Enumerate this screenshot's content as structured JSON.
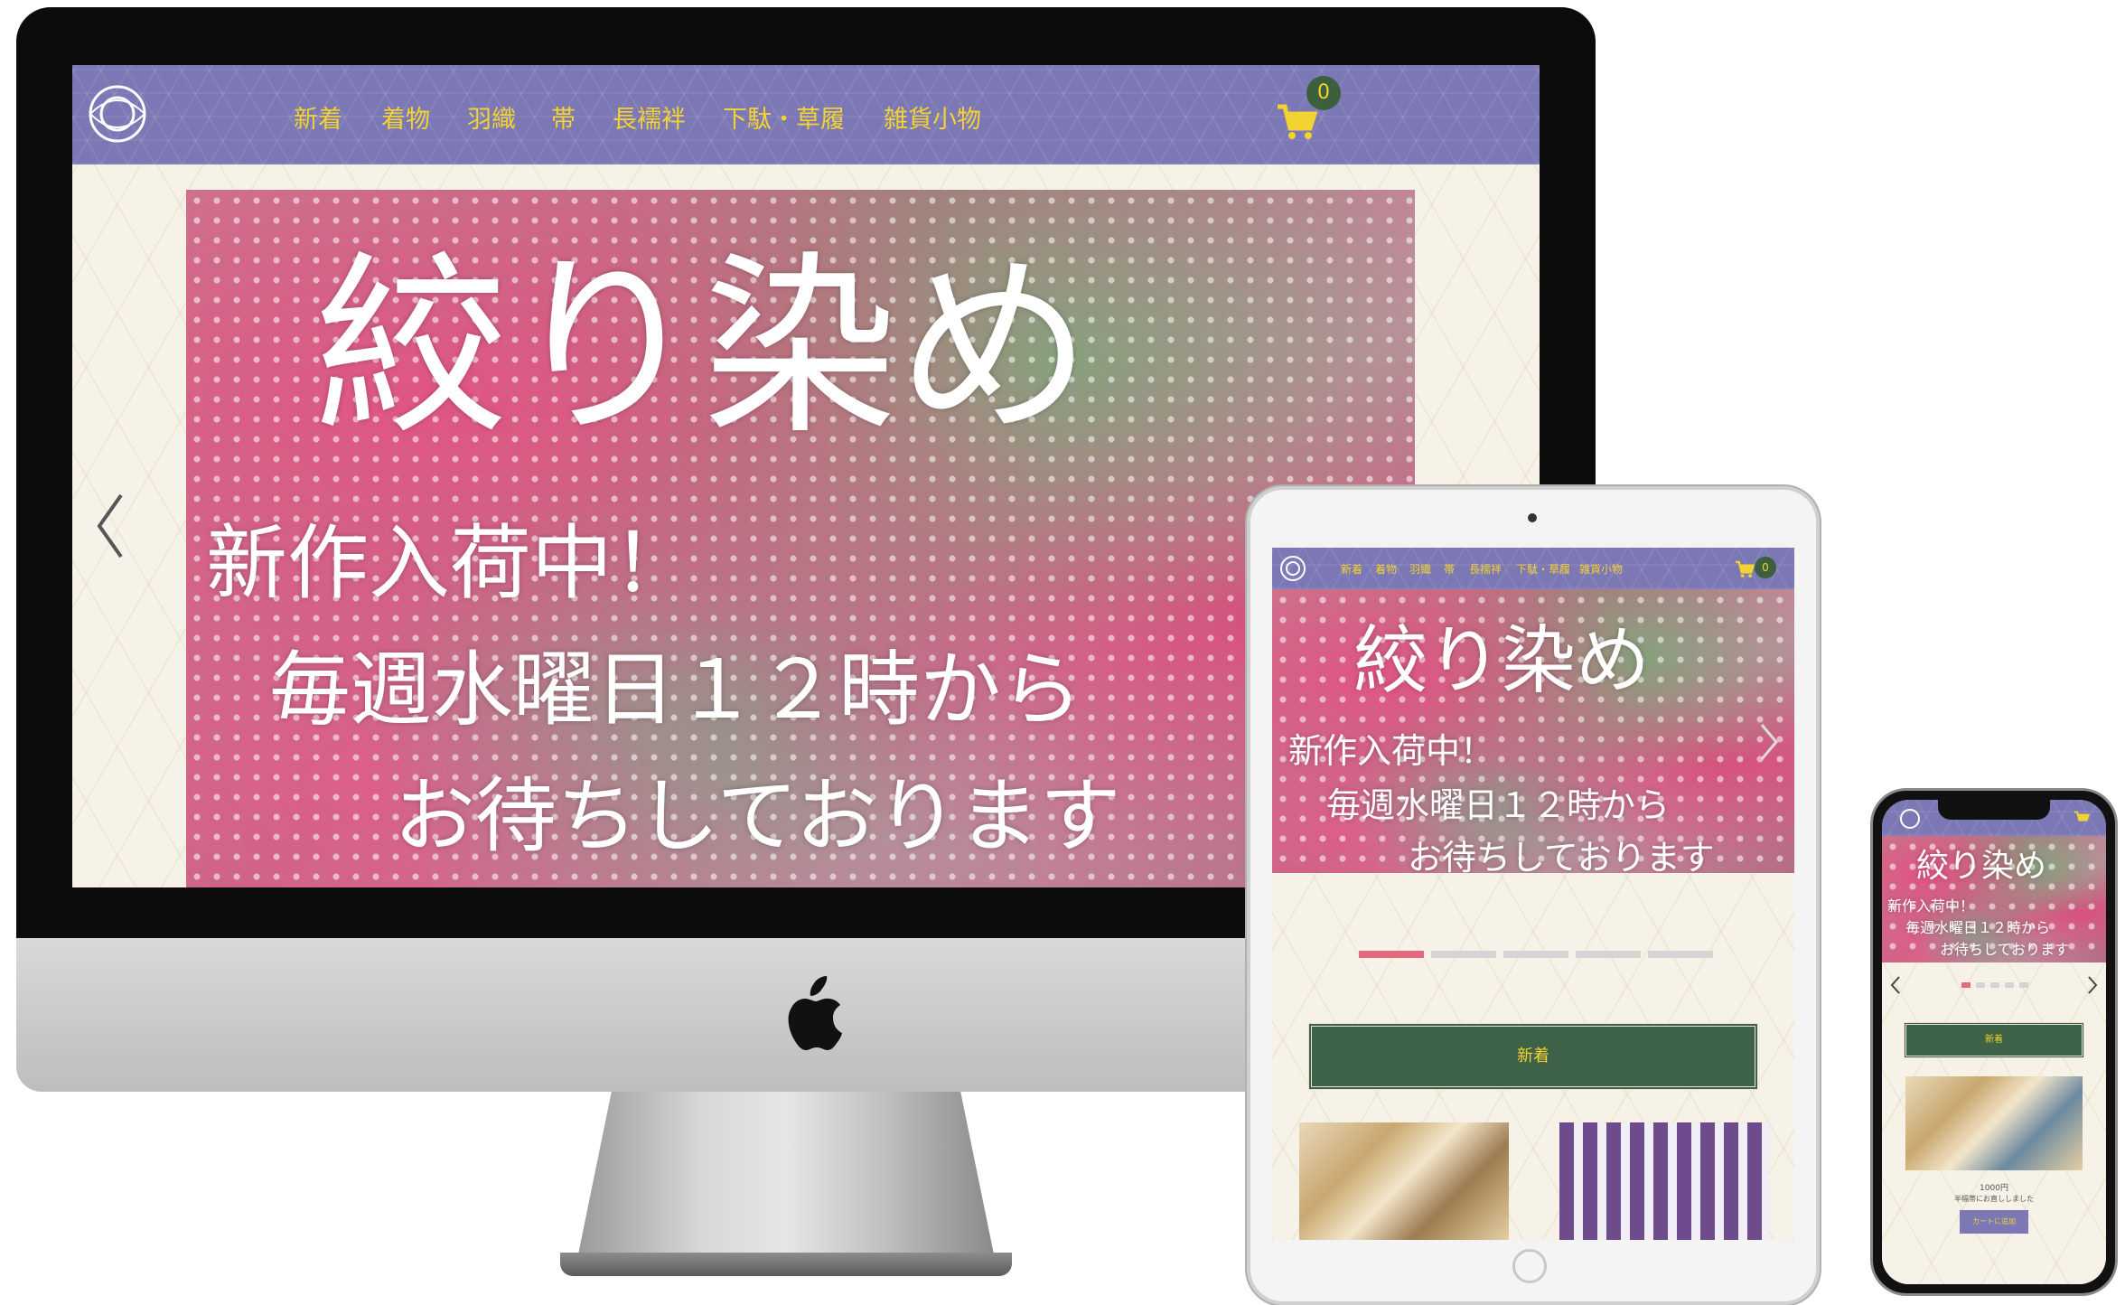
{
  "nav": {
    "items": [
      {
        "label": "新着"
      },
      {
        "label": "着物"
      },
      {
        "label": "羽織"
      },
      {
        "label": "帯"
      },
      {
        "label": "長襦袢"
      },
      {
        "label": "下駄・草履"
      },
      {
        "label": "雑貨小物"
      }
    ],
    "cart_count": "0"
  },
  "hero": {
    "title": "絞り染め",
    "line1": "新作入荷中！",
    "line2": "毎週水曜日１２時から",
    "line3": "お待ちしております"
  },
  "section": {
    "new_arrivals_label": "新着"
  },
  "product": {
    "price": "1000円",
    "note": "半幅帯にお直ししました",
    "cart_button": "カートに追加"
  },
  "colors": {
    "nav_bg": "#7b78b5",
    "nav_text": "#f3d330",
    "section_green": "#3e6248",
    "active_dot": "#e26a7f",
    "cream_bg": "#f6f2e7"
  },
  "icons": {
    "cart": "cart-icon",
    "logo": "peony-logo-icon",
    "prev": "chevron-left-icon",
    "next": "chevron-right-icon",
    "apple": "apple-logo-icon"
  }
}
